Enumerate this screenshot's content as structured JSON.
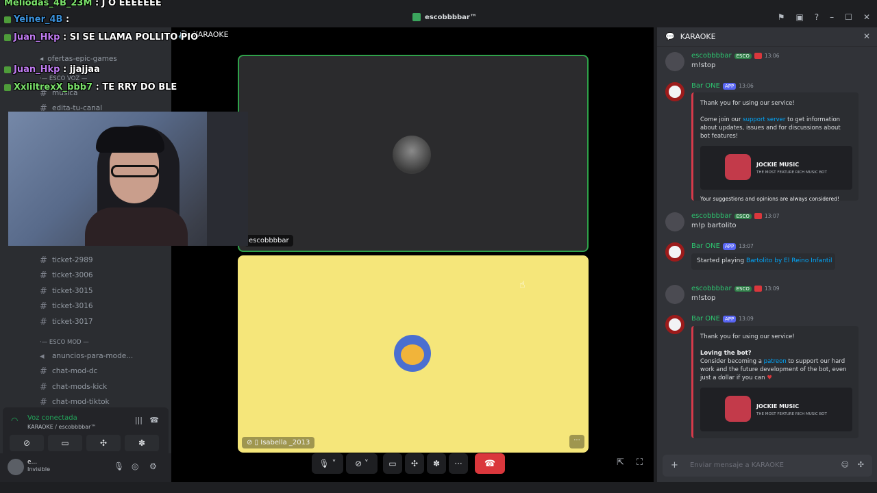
{
  "window": {
    "title": "escobbbbar™"
  },
  "overlay_chat": [
    {
      "user": "Meliodas_4B_23M",
      "text": ": J O EEEEEEE"
    },
    {
      "user": "Yeiner_4B",
      "text": ":"
    },
    {
      "user": "Juan_Hkp",
      "text": ": SI SE LLAMA POLLITO PIO"
    },
    {
      "user": "Juan_Hkp",
      "text": ": jjajjaa"
    },
    {
      "user": "XxliltrexX_bbb7",
      "text": ": TE RRY DO BLE"
    }
  ],
  "voice_header": {
    "channel": "KARAOKE"
  },
  "sidebar": {
    "channels": [
      {
        "label": "ofertas-epic-games"
      },
      {
        "label": "música"
      },
      {
        "label": "edita-tu-canal"
      },
      {
        "label": "ticket-2989"
      },
      {
        "label": "ticket-3006"
      },
      {
        "label": "ticket-3015"
      },
      {
        "label": "ticket-3016"
      },
      {
        "label": "ticket-3017"
      },
      {
        "label": "anuncios-para-mode..."
      },
      {
        "label": "chat-mod-dc"
      },
      {
        "label": "chat-mods-kick"
      },
      {
        "label": "chat-mod-tiktok"
      }
    ],
    "category_voz": "·— ESCO VOZ —",
    "category_mod": "·— ESCO MOD —"
  },
  "voice_status": {
    "title": "Voz conectada",
    "subtitle": "KARAOKE / escobbbbar™"
  },
  "user_panel": {
    "name": "e...",
    "status": "Invisible"
  },
  "tiles": [
    {
      "name": "escobbbbar"
    },
    {
      "name": "Isabella _2013"
    }
  ],
  "chat": {
    "channel": "KARAOKE",
    "input_placeholder": "Enviar mensaje a KARAOKE",
    "messages": [
      {
        "user": "escobbbbar",
        "tag": "ESCO",
        "time": "13:06",
        "text": "m!stop"
      },
      {
        "user": "Bar ONE",
        "tag": "APP",
        "time": "13:06"
      },
      {
        "user": "escobbbbar",
        "tag": "ESCO",
        "time": "13:07",
        "text": "m!p bartolito"
      },
      {
        "user": "Bar ONE",
        "tag": "APP",
        "time": "13:07"
      },
      {
        "user": "escobbbbar",
        "tag": "ESCO",
        "time": "13:09",
        "text": "m!stop"
      },
      {
        "user": "Bar ONE",
        "tag": "APP",
        "time": "13:09"
      }
    ],
    "embed1": {
      "thanks": "Thank you for using our service!",
      "come": "Come join our",
      "support": "support server",
      "rest": "to get information about updates, issues and for discussions about bot features!",
      "jockie_title": "JOCKIE MUSIC",
      "jockie_sub": "THE MOST FEATURE RICH MUSIC BOT",
      "footer": "Your suggestions and opinions are always considered!"
    },
    "playing": {
      "prefix": "Started playing",
      "track": "Bartolito by El Reino Infantil"
    },
    "embed2": {
      "thanks": "Thank you for using our service!",
      "loving": "Loving the bot?",
      "consider": "Consider becoming a",
      "patreon": "patreon",
      "rest": "to support our hard work and the future development of the bot, even just a dollar if you can",
      "jockie_title": "JOCKIE MUSIC",
      "jockie_sub": "THE MOST FEATURE RICH MUSIC BOT"
    }
  },
  "colors": {
    "accent": "#5865f2",
    "green": "#23a55a",
    "hangup": "#da373c",
    "tile2": "#f5e67a"
  }
}
